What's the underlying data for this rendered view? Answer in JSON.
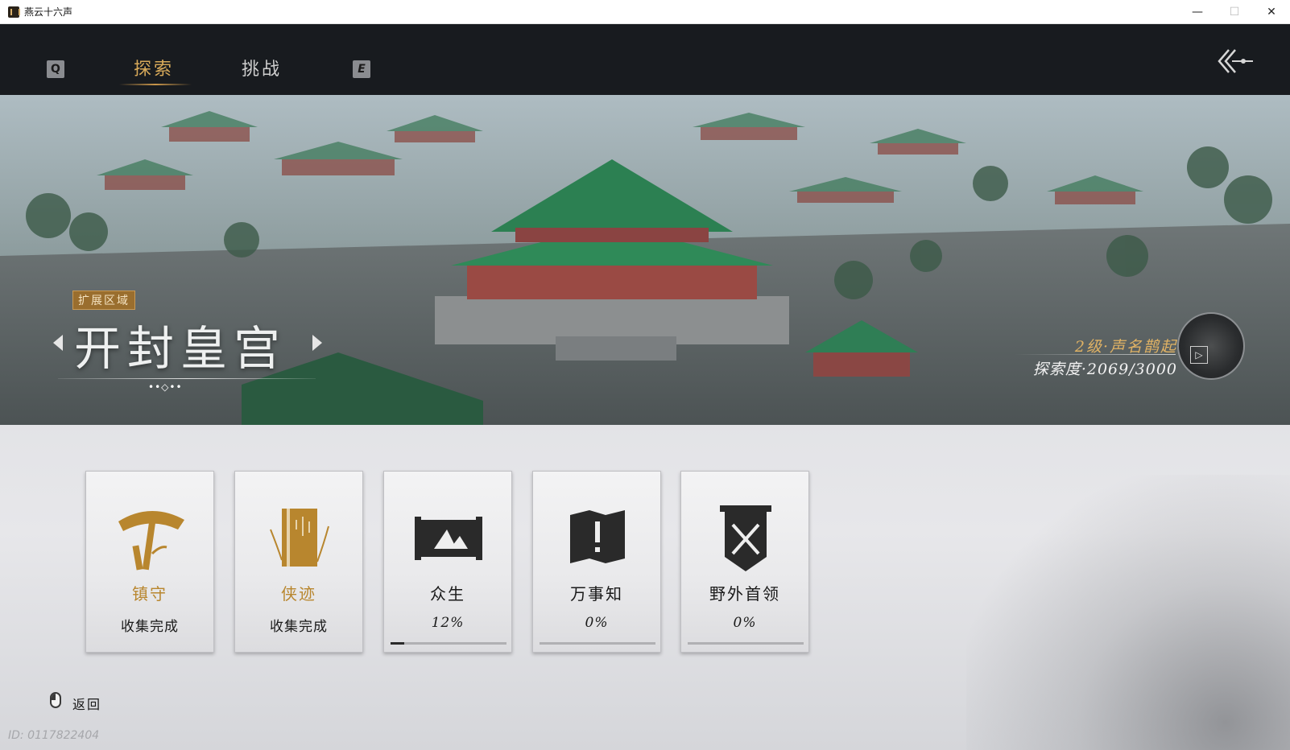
{
  "window": {
    "title": "燕云十六声",
    "minimize": "—",
    "maximize": "☐",
    "close": "✕"
  },
  "nav": {
    "prev_key": "Q",
    "next_key": "E",
    "tabs": [
      {
        "label": "探索",
        "active": true
      },
      {
        "label": "挑战",
        "active": false
      }
    ],
    "back_icon": "back-arrow-icon"
  },
  "region": {
    "tag": "扩展区域",
    "name": "开封皇宫",
    "page_indicator": "••◇••",
    "rank": "2级·声名鹊起",
    "progress_text": "探索度·2069/3000"
  },
  "cards": [
    {
      "title": "镇守",
      "status": "收集完成",
      "icon": "hat-icon",
      "completed": true
    },
    {
      "title": "侠迹",
      "status": "收集完成",
      "icon": "book-icon",
      "completed": true
    },
    {
      "title": "众生",
      "status": "12%",
      "icon": "scroll-icon",
      "completed": false,
      "progress": 0.12
    },
    {
      "title": "万事知",
      "status": "0%",
      "icon": "map-exclaim-icon",
      "completed": false,
      "progress": 0
    },
    {
      "title": "野外首领",
      "status": "0%",
      "icon": "crossed-swords-banner-icon",
      "completed": false,
      "progress": 0
    }
  ],
  "footer": {
    "back_label": "返回",
    "uid": "ID: 0117822404"
  },
  "colors": {
    "gold": "#b8862e",
    "tab_active": "#d8aa5a",
    "nav_bg": "#181b1f"
  }
}
